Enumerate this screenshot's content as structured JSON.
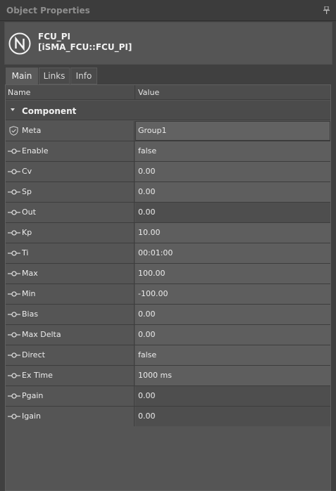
{
  "panel": {
    "title": "Object Properties"
  },
  "object": {
    "name": "FCU_PI",
    "type": "[iSMA_FCU::FCU_PI]",
    "icon": "niagara-n-icon"
  },
  "tabs": [
    {
      "label": "Main",
      "active": true
    },
    {
      "label": "Links",
      "active": false
    },
    {
      "label": "Info",
      "active": false
    }
  ],
  "grid": {
    "columns": {
      "name": "Name",
      "value": "Value"
    },
    "group": "Component",
    "rows": [
      {
        "name": "Meta",
        "value": "Group1",
        "icon": "shield-icon"
      },
      {
        "name": "Enable",
        "value": "false",
        "icon": "slot-icon"
      },
      {
        "name": "Cv",
        "value": "0.00",
        "icon": "slot-icon"
      },
      {
        "name": "Sp",
        "value": "0.00",
        "icon": "slot-icon"
      },
      {
        "name": "Out",
        "value": "0.00",
        "icon": "slot-icon"
      },
      {
        "name": "Kp",
        "value": "10.00",
        "icon": "slot-icon"
      },
      {
        "name": "Ti",
        "value": "00:01:00",
        "icon": "slot-icon"
      },
      {
        "name": "Max",
        "value": "100.00",
        "icon": "slot-icon"
      },
      {
        "name": "Min",
        "value": "-100.00",
        "icon": "slot-icon"
      },
      {
        "name": "Bias",
        "value": "0.00",
        "icon": "slot-icon"
      },
      {
        "name": "Max Delta",
        "value": "0.00",
        "icon": "slot-icon"
      },
      {
        "name": "Direct",
        "value": "false",
        "icon": "slot-icon"
      },
      {
        "name": "Ex Time",
        "value": "1000 ms",
        "icon": "slot-icon"
      },
      {
        "name": "Pgain",
        "value": "0.00",
        "icon": "slot-icon"
      },
      {
        "name": "Igain",
        "value": "0.00",
        "icon": "slot-icon"
      }
    ]
  }
}
